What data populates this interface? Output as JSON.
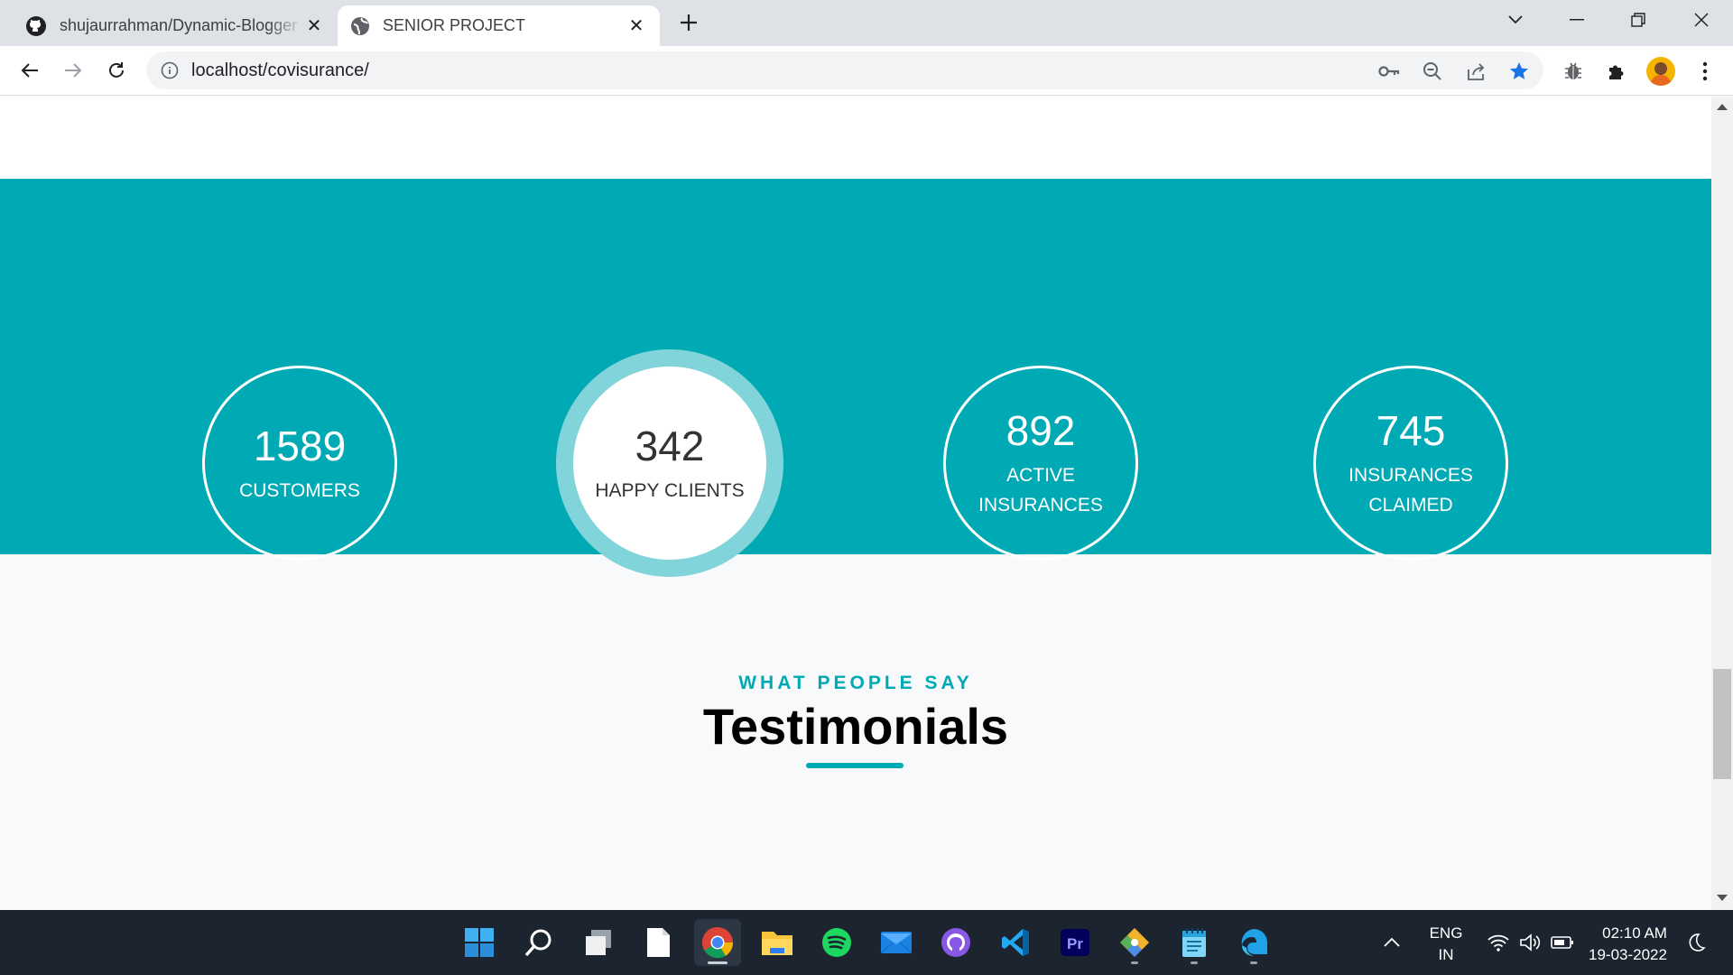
{
  "browser": {
    "tabs": [
      {
        "title": "shujaurrahman/Dynamic-Blogger",
        "icon": "github-icon",
        "active": false
      },
      {
        "title": "SENIOR PROJECT",
        "icon": "globe-icon",
        "active": true
      }
    ],
    "address": "localhost/covisurance/"
  },
  "stats": [
    {
      "number": "1589",
      "label": "CUSTOMERS"
    },
    {
      "number": "342",
      "label": "HAPPY CLIENTS"
    },
    {
      "number": "892",
      "label": "ACTIVE INSURANCES"
    },
    {
      "number": "745",
      "label": "INSURANCES CLAIMED"
    }
  ],
  "testimonials": {
    "subtitle": "WHAT PEOPLE SAY",
    "title": "Testimonials"
  },
  "taskbar": {
    "apps": [
      "windows-start-icon",
      "search-icon",
      "task-view-icon",
      "file-icon",
      "chrome-icon",
      "file-explorer-icon",
      "spotify-icon",
      "mail-icon",
      "github-desktop-icon",
      "vscode-icon",
      "premiere-pro-icon",
      "git-icon",
      "notepad-icon",
      "edge-icon"
    ],
    "lang_top": "ENG",
    "lang_bottom": "IN",
    "time": "02:10 AM",
    "date": "19-03-2022"
  },
  "colors": {
    "accent": "#00aab5",
    "accent_light": "#80d4da",
    "taskbar": "#1c2430",
    "tabstrip": "#dee1e6"
  }
}
